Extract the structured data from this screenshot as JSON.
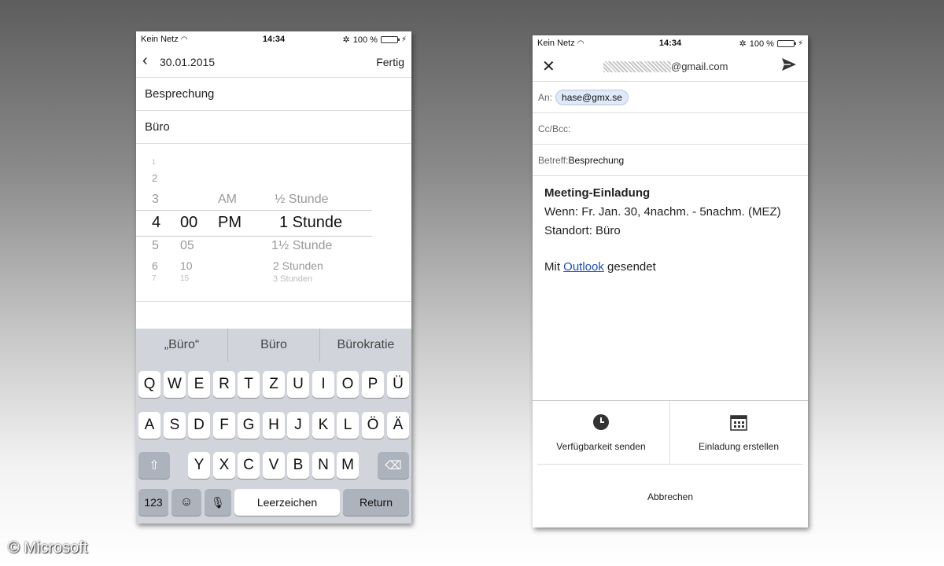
{
  "left_phone": {
    "status": {
      "carrier": "Kein Netz",
      "time": "14:34",
      "battery": "100 %"
    },
    "nav": {
      "date": "30.01.2015",
      "done": "Fertig"
    },
    "fields": [
      "Besprechung",
      "Büro"
    ],
    "picker": {
      "hours": [
        "1",
        "2",
        "3",
        "4",
        "5",
        "6",
        "7"
      ],
      "minutes": [
        "00",
        "05",
        "10",
        "15"
      ],
      "ampm": [
        "AM",
        "PM"
      ],
      "durations": [
        "½ Stunde",
        "1 Stunde",
        "1½ Stunde",
        "2 Stunden",
        "3 Stunden"
      ]
    },
    "suggestions": [
      "„Büro“",
      "Büro",
      "Bürokratie"
    ],
    "keyboard": {
      "row1": [
        "Q",
        "W",
        "E",
        "R",
        "T",
        "Z",
        "U",
        "I",
        "O",
        "P",
        "Ü"
      ],
      "row2": [
        "A",
        "S",
        "D",
        "F",
        "G",
        "H",
        "J",
        "K",
        "L",
        "Ö",
        "Ä"
      ],
      "row3": [
        "Y",
        "X",
        "C",
        "V",
        "B",
        "N",
        "M"
      ],
      "num_key": "123",
      "space": "Leerzeichen",
      "return": "Return"
    }
  },
  "right_phone": {
    "status": {
      "carrier": "Kein Netz",
      "time": "14:34",
      "battery": "100 %"
    },
    "from": "@gmail.com",
    "to_label": "An:",
    "to_chip": "hase@gmx.se",
    "cc_label": "Cc/Bcc:",
    "subject_label": "Betreff:",
    "subject": "Besprechung",
    "body": {
      "heading": "Meeting-Einladung",
      "when": "Wenn: Fr. Jan. 30, 4nachm. - 5nachm. (MEZ)",
      "where": "Standort: Büro",
      "sent_prefix": "Mit ",
      "sent_link": "Outlook",
      "sent_suffix": " gesendet"
    },
    "actions": {
      "availability": "Verfügbarkeit senden",
      "invite": "Einladung erstellen",
      "cancel": "Abbrechen"
    }
  },
  "copyright": "© Microsoft"
}
